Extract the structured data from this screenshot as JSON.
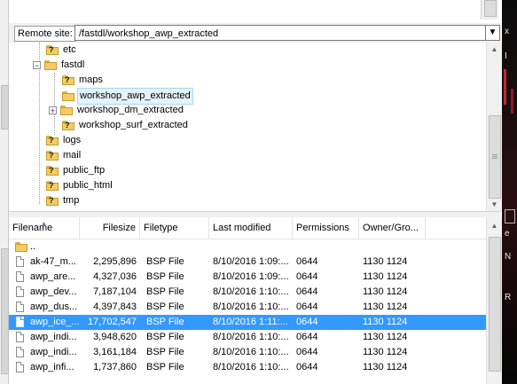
{
  "remote": {
    "label": "Remote site:",
    "path": "/fastdl/workshop_awp_extracted"
  },
  "tree": {
    "items": [
      {
        "label": "etc",
        "icon": "folder-unknown-icon"
      },
      {
        "label": "fastdl",
        "icon": "folder-open-icon",
        "expander": "−"
      },
      {
        "label": "maps",
        "icon": "folder-unknown-icon"
      },
      {
        "label": "workshop_awp_extracted",
        "icon": "folder-icon",
        "selected": true
      },
      {
        "label": "workshop_dm_extracted",
        "icon": "folder-icon",
        "expander": "+"
      },
      {
        "label": "workshop_surf_extracted",
        "icon": "folder-unknown-icon"
      },
      {
        "label": "logs",
        "icon": "folder-unknown-icon"
      },
      {
        "label": "mail",
        "icon": "folder-unknown-icon"
      },
      {
        "label": "public_ftp",
        "icon": "folder-unknown-icon"
      },
      {
        "label": "public_html",
        "icon": "folder-unknown-icon"
      },
      {
        "label": "tmp",
        "icon": "folder-unknown-icon"
      }
    ]
  },
  "list": {
    "columns": [
      "Filename",
      "Filesize",
      "Filetype",
      "Last modified",
      "Permissions",
      "Owner/Gro..."
    ],
    "parent": "..",
    "rows": [
      {
        "name": "ak-47_m...",
        "size": "2,295,896",
        "type": "BSP File",
        "modified": "8/10/2016 1:09:...",
        "perms": "0644",
        "owner": "1130 1124"
      },
      {
        "name": "awp_are...",
        "size": "4,327,036",
        "type": "BSP File",
        "modified": "8/10/2016 1:09:...",
        "perms": "0644",
        "owner": "1130 1124"
      },
      {
        "name": "awp_dev...",
        "size": "7,187,104",
        "type": "BSP File",
        "modified": "8/10/2016 1:10:...",
        "perms": "0644",
        "owner": "1130 1124"
      },
      {
        "name": "awp_dus...",
        "size": "4,397,843",
        "type": "BSP File",
        "modified": "8/10/2016 1:10:...",
        "perms": "0644",
        "owner": "1130 1124"
      },
      {
        "name": "awp_ice_...",
        "size": "17,702,547",
        "type": "BSP File",
        "modified": "8/10/2016 1:11:...",
        "perms": "0644",
        "owner": "1130 1124",
        "selected": true
      },
      {
        "name": "awp_indi...",
        "size": "3,948,620",
        "type": "BSP File",
        "modified": "8/10/2016 1:10:...",
        "perms": "0644",
        "owner": "1130 1124"
      },
      {
        "name": "awp_indi...",
        "size": "3,161,184",
        "type": "BSP File",
        "modified": "8/10/2016 1:10:...",
        "perms": "0644",
        "owner": "1130 1124"
      },
      {
        "name": "awp_infi...",
        "size": "1,737,860",
        "type": "BSP File",
        "modified": "8/10/2016 1:10:...",
        "perms": "0644",
        "owner": "1130 1124"
      }
    ]
  },
  "side_glyphs": [
    "x",
    "I",
    "e",
    "N",
    "R"
  ]
}
